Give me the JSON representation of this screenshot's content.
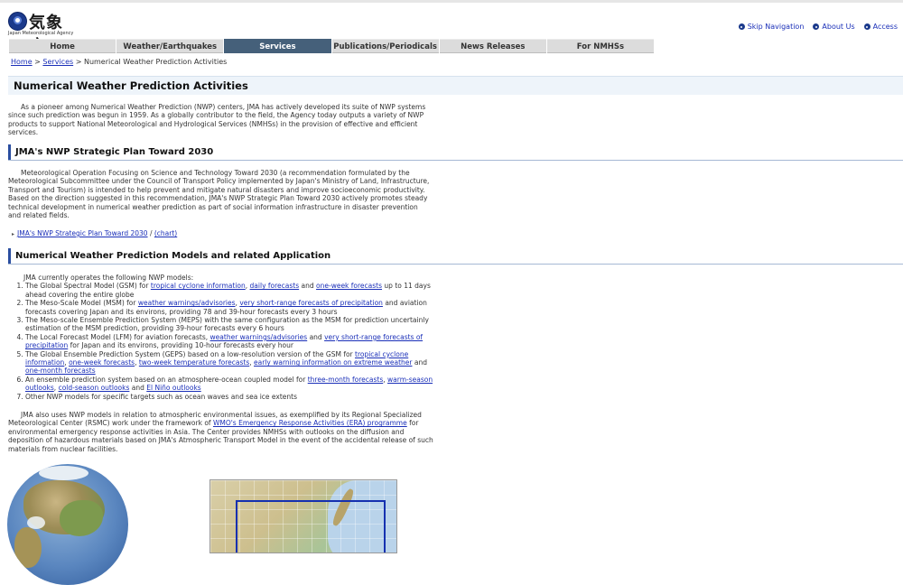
{
  "header": {
    "logo_kanji": "気象庁",
    "logo_en": "Japan Meteorological Agency",
    "util_links": [
      "Skip Navigation",
      "About Us",
      "Access"
    ]
  },
  "nav": {
    "items": [
      "Home",
      "Weather/Earthquakes",
      "Services",
      "Publications/Periodicals",
      "News Releases",
      "For NMHSs"
    ],
    "active": "Services"
  },
  "breadcrumb": {
    "home": "Home",
    "sep1": " > ",
    "services": "Services",
    "sep2": " > ",
    "current": "Numerical Weather Prediction Activities"
  },
  "page": {
    "title": "Numerical Weather Prediction Activities",
    "intro": "As a pioneer among Numerical Weather Prediction (NWP) centers, JMA has actively developed its suite of NWP systems since such prediction was begun in 1959. As a globally contributor to the field, the Agency today outputs a variety of NWP products to support National Meteorological and Hydrological Services (NMHSs) in the provision of effective and efficient services."
  },
  "section1": {
    "heading": "JMA's NWP Strategic Plan Toward 2030",
    "body": "Meteorological Operation Focusing on Science and Technology Toward 2030 (a recommendation formulated by the Meteorological Subcommittee under the Council of Transport Policy implemented by Japan's Ministry of Land, Infrastructure, Transport and Tourism) is intended to help prevent and mitigate natural disasters and improve socioeconomic productivity. Based on the direction suggested in this recommendation, JMA's NWP Strategic Plan Toward 2030 actively promotes steady technical development in numerical weather prediction as part of social information infrastructure in disaster prevention and related fields.",
    "link1": "JMA's NWP Strategic Plan Toward 2030",
    "link_sep": " / ",
    "link2": "(chart)"
  },
  "section2": {
    "heading": "Numerical Weather Prediction Models and related Application",
    "intro": "JMA currently operates the following NWP models:",
    "items": {
      "i1": {
        "t1": "The Global Spectral Model (GSM) for ",
        "l1": "tropical cyclone information",
        "t2": ", ",
        "l2": "daily forecasts",
        "t3": " and ",
        "l3": "one-week forecasts",
        "t4": " up to 11 days ahead covering the entire globe"
      },
      "i2": {
        "t1": "The Meso-Scale Model (MSM) for ",
        "l1": "weather warnings/advisories",
        "t2": ", ",
        "l2": "very short-range forecasts of precipitation",
        "t3": " and aviation forecasts covering Japan and its environs, providing 78 and 39-hour forecasts every 3 hours"
      },
      "i3": {
        "t1": "The Meso-scale Ensemble Prediction System (MEPS) with the same configuration as the MSM for prediction uncertainly estimation of the MSM prediction, providing 39-hour forecasts every 6 hours"
      },
      "i4": {
        "t1": "The Local Forecast Model (LFM) for aviation forecasts, ",
        "l1": "weather warnings/advisories",
        "t2": " and ",
        "l2": "very short-range forecasts of precipitation",
        "t3": " for Japan and its environs, providing 10-hour forecasts every hour"
      },
      "i5": {
        "t1": "The Global Ensemble Prediction System (GEPS) based on a low-resolution version of the GSM for ",
        "l1": "tropical cyclone information",
        "t2": ", ",
        "l2": "one-week forecasts",
        "t3": ", ",
        "l3": "two-week temperature forecasts",
        "t4": ", ",
        "l4": "early warning information on extreme weather",
        "t5": " and ",
        "l5": "one-month forecasts"
      },
      "i6": {
        "t1": "An ensemble prediction system based on an atmosphere-ocean coupled model for ",
        "l1": "three-month forecasts",
        "t2": ", ",
        "l2": "warm-season outlooks",
        "t3": ", ",
        "l3": "cold-season outlooks",
        "t4": " and ",
        "l4": "El Niño outlooks"
      },
      "i7": {
        "t1": "Other NWP models for specific targets such as ocean waves and sea ice extents"
      }
    },
    "body2": {
      "t1": "JMA also uses NWP models in relation to atmospheric environmental issues, as exemplified by its Regional Specialized Meteorological Center (RSMC) work under the framework of ",
      "l1": "WMO's Emergency Response Activities (ERA) programme",
      "t2": " for environmental emergency response activities in Asia. The Center provides NMHSs with outlooks on the diffusion and deposition of hazardous materials based on JMA's Atmospheric Transport Model in the event of the accidental release of such materials from nuclear facilities."
    }
  },
  "colors": {
    "nav_active": "#45607a",
    "nav_inactive": "#dcdcdc",
    "link": "#1a2fb8",
    "heading_accent": "#2a4ea0",
    "title_bg": "#eef4fa"
  }
}
